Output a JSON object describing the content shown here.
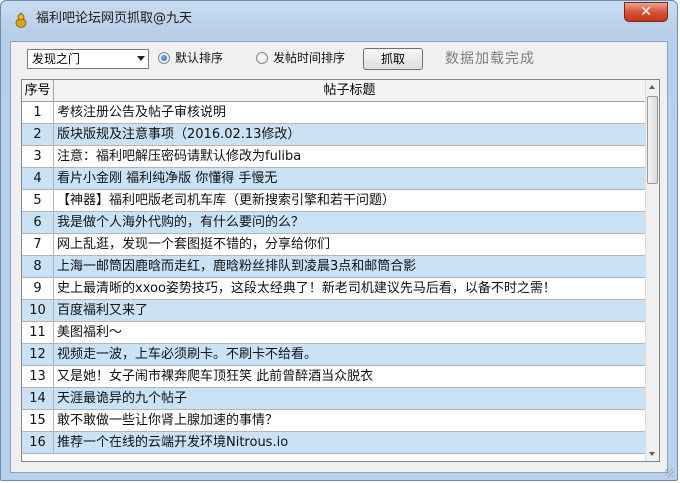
{
  "window": {
    "title": "福利吧论坛网页抓取@九天",
    "close_glyph": "✕"
  },
  "toolbar": {
    "select_value": "发现之门",
    "sort_default_label": "默认排序",
    "sort_time_label": "发帖时间排序",
    "fetch_label": "抓取",
    "status": "数据加载完成"
  },
  "table": {
    "columns": [
      "序号",
      "帖子标题"
    ],
    "rows": [
      {
        "n": "1",
        "title": "考核注册公告及帖子审核说明"
      },
      {
        "n": "2",
        "title": "版块版规及注意事项（2016.02.13修改）"
      },
      {
        "n": "3",
        "title": "注意：福利吧解压密码请默认修改为fuliba"
      },
      {
        "n": "4",
        "title": "看片小金刚 福利纯净版 你懂得 手慢无"
      },
      {
        "n": "5",
        "title": "【神器】福利吧版老司机车库（更新搜索引擎和若干问题）"
      },
      {
        "n": "6",
        "title": "我是做个人海外代购的，有什么要问的么？"
      },
      {
        "n": "7",
        "title": "网上乱逛，发现一个套图挺不错的，分享给你们"
      },
      {
        "n": "8",
        "title": "上海一邮筒因鹿晗而走红，鹿晗粉丝排队到凌晨3点和邮筒合影"
      },
      {
        "n": "9",
        "title": "史上最清晰的xxoo姿势技巧，这段太经典了！新老司机建议先马后看，以备不时之需！"
      },
      {
        "n": "10",
        "title": "百度福利又来了"
      },
      {
        "n": "11",
        "title": "美图福利～"
      },
      {
        "n": "12",
        "title": "视频走一波，上车必须刷卡。不刷卡不给看。"
      },
      {
        "n": "13",
        "title": "又是她！女子闹市裸奔爬车顶狂笑 此前曾醉酒当众脱衣"
      },
      {
        "n": "14",
        "title": "天涯最诡异的九个帖子"
      },
      {
        "n": "15",
        "title": "敢不敢做一些让你肾上腺加速的事情？"
      },
      {
        "n": "16",
        "title": "推荐一个在线的云端开发环境Nitrous.io"
      }
    ]
  }
}
